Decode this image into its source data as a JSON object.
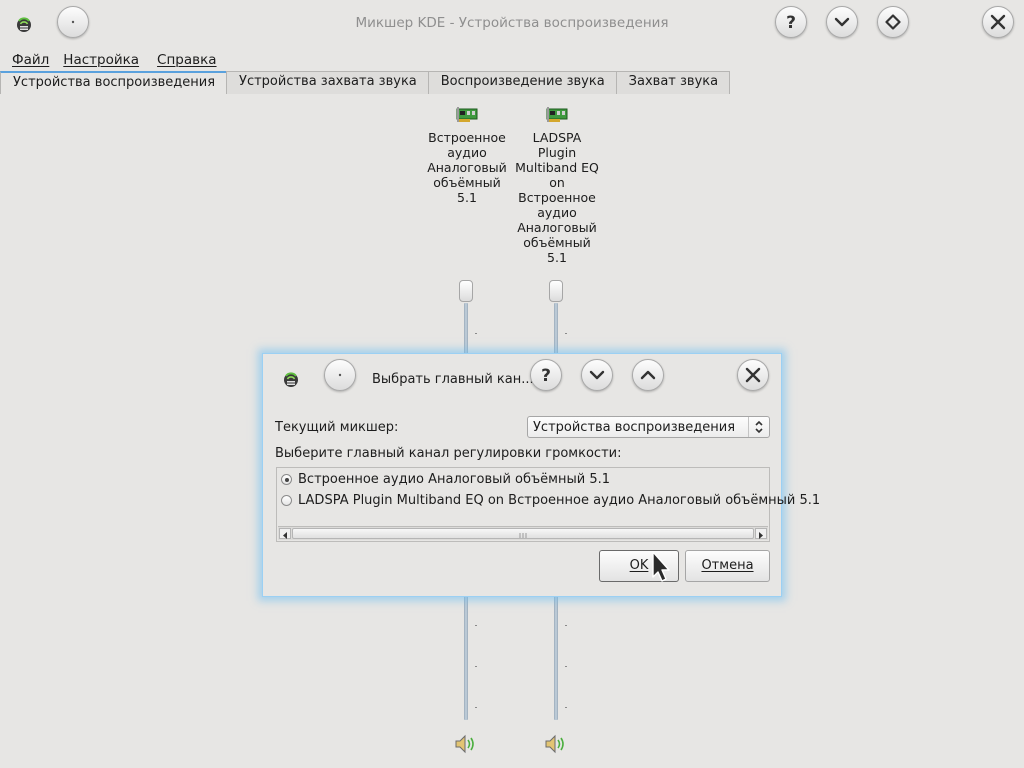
{
  "window": {
    "title": "Микшер KDE - Устройства воспроизведения"
  },
  "menu": [
    {
      "label": "Файл"
    },
    {
      "label": "Настройка"
    },
    {
      "label": "Справка"
    }
  ],
  "tabs": [
    {
      "label": "Устройства воспроизведения",
      "active": true
    },
    {
      "label": "Устройства захвата звука",
      "active": false
    },
    {
      "label": "Воспроизведение звука",
      "active": false
    },
    {
      "label": "Захват звука",
      "active": false
    }
  ],
  "devices": [
    {
      "name_lines": [
        "Встроенное",
        "аудио",
        "Аналоговый",
        "объёмный",
        "5.1"
      ],
      "icon": "sound-card-icon",
      "mute_icon": "speaker-volume-icon"
    },
    {
      "name_lines": [
        "LADSPA",
        "Plugin",
        "Multiband EQ",
        "on",
        "Встроенное",
        "аудио",
        "Аналоговый",
        "объёмный",
        "5.1"
      ],
      "icon": "sound-card-icon",
      "mute_icon": "speaker-volume-icon"
    }
  ],
  "dialog": {
    "title": "Выбрать главный кан...",
    "current_mixer_label": "Текущий микшер:",
    "current_mixer_value": "Устройства воспроизведения",
    "choose_label": "Выберите главный канал регулировки громкости:",
    "options": [
      {
        "label": "Встроенное аудио Аналоговый объёмный 5.1",
        "selected": true
      },
      {
        "label": "LADSPA Plugin Multiband EQ on Встроенное аудио Аналоговый объёмный 5.1",
        "selected": false
      }
    ],
    "ok_label": "OK",
    "cancel_label": "Отмена"
  },
  "colors": {
    "background": "#e7e6e4",
    "accent": "#5aa1dd",
    "dialog_glow": "#6ebef0"
  }
}
